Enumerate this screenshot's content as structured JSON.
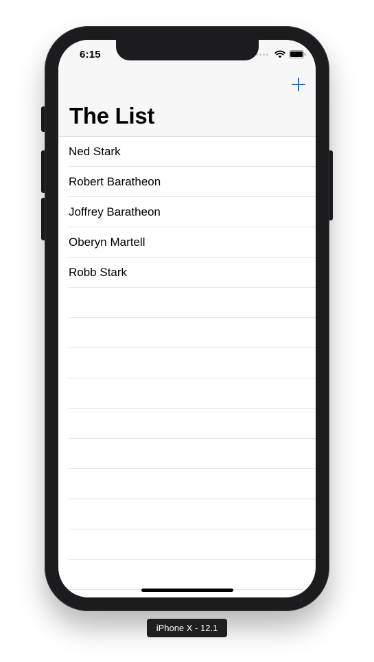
{
  "status_bar": {
    "time": "6:15",
    "icons": [
      "signal-dots-icon",
      "wifi-icon",
      "battery-icon"
    ]
  },
  "nav": {
    "title": "The List",
    "add_button_icon": "plus-icon",
    "accent_color": "#007aff"
  },
  "list": {
    "items": [
      {
        "label": "Ned Stark"
      },
      {
        "label": "Robert Baratheon"
      },
      {
        "label": "Joffrey Baratheon"
      },
      {
        "label": "Oberyn Martell"
      },
      {
        "label": "Robb Stark"
      }
    ]
  },
  "simulator": {
    "device_label": "iPhone X - 12.1"
  }
}
